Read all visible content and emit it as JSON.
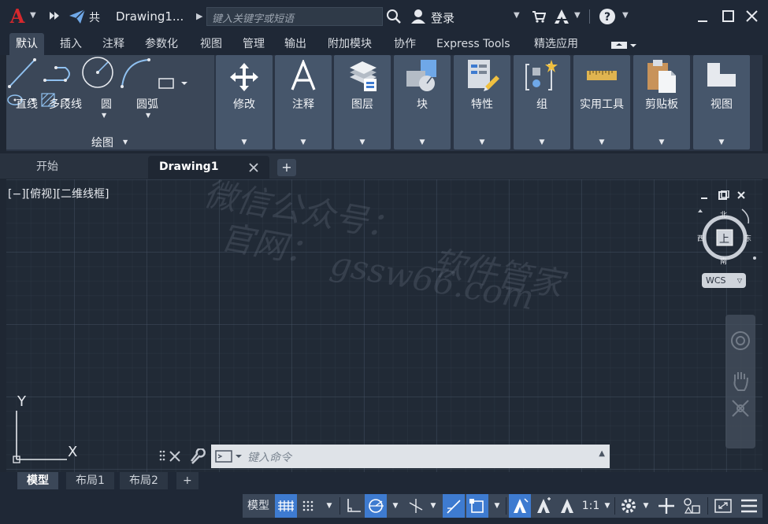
{
  "titlebar": {
    "share": "共",
    "doc_title": "Drawing1...",
    "search_placeholder": "键入关键字或短语",
    "login": "登录"
  },
  "ribbon_tabs": [
    "默认",
    "插入",
    "注释",
    "参数化",
    "视图",
    "管理",
    "输出",
    "附加模块",
    "协作",
    "Express Tools",
    "精选应用"
  ],
  "draw_group": {
    "line": "直线",
    "polyline": "多段线",
    "circle": "圆",
    "arc": "圆弧",
    "group_label": "绘图"
  },
  "ribbon_panels": [
    "修改",
    "注释",
    "图层",
    "块",
    "特性",
    "组",
    "实用工具",
    "剪贴板",
    "视图"
  ],
  "doc_tabs": {
    "start": "开始",
    "drawing": "Drawing1",
    "add": "+"
  },
  "viewport": {
    "label": "[−][俯视][二维线框]",
    "watermark_lines": [
      "微信公众号：",
      "官网：",
      "软件管家",
      "gssw66.com"
    ],
    "viewcube": {
      "north": "北",
      "south": "南",
      "east": "东",
      "west": "西",
      "top": "上",
      "wcs": "WCS"
    },
    "ucs": {
      "y": "Y",
      "x": "X"
    }
  },
  "command_line": {
    "placeholder": "键入命令"
  },
  "layout_tabs": [
    "模型",
    "布局1",
    "布局2",
    "+"
  ],
  "status": {
    "model": "模型",
    "scale": "1:1"
  },
  "colors": {
    "accent": "#3e7bd0",
    "logo": "#d6282d",
    "panel": "#46566b",
    "bg": "#212a36"
  }
}
